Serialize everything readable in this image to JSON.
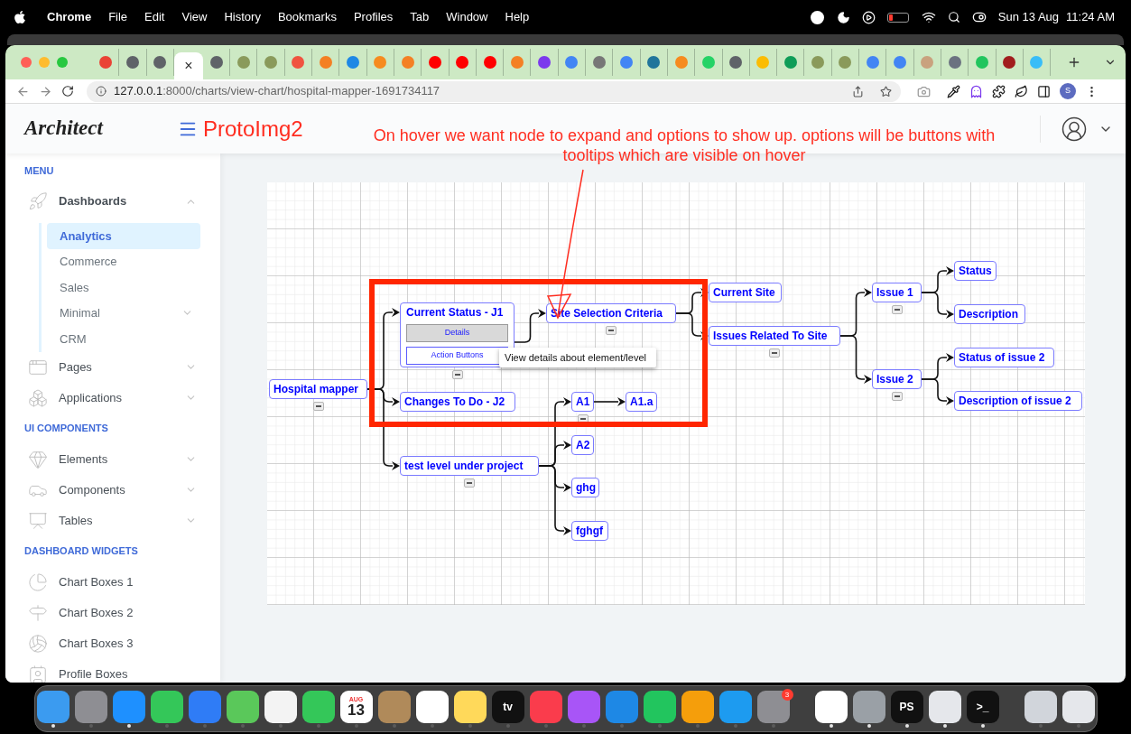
{
  "menubar": {
    "app": "Chrome",
    "menus": [
      "File",
      "Edit",
      "View",
      "History",
      "Bookmarks",
      "Profiles",
      "Tab",
      "Window",
      "Help"
    ],
    "date": "Sun 13 Aug",
    "time": "11:24 AM"
  },
  "browser": {
    "tabs": [
      {
        "selected": false
      },
      {
        "selected": false
      },
      {
        "selected": false
      },
      {
        "selected": true
      },
      {
        "selected": false
      },
      {
        "selected": false
      },
      {
        "selected": false
      },
      {
        "selected": false
      },
      {
        "selected": false
      },
      {
        "selected": false
      },
      {
        "selected": false
      },
      {
        "selected": false
      },
      {
        "selected": false
      },
      {
        "selected": false
      },
      {
        "selected": false
      },
      {
        "selected": false
      },
      {
        "selected": false
      },
      {
        "selected": false
      },
      {
        "selected": false
      },
      {
        "selected": false
      },
      {
        "selected": false
      },
      {
        "selected": false
      },
      {
        "selected": false
      },
      {
        "selected": false
      },
      {
        "selected": false
      },
      {
        "selected": false
      },
      {
        "selected": false
      },
      {
        "selected": false
      },
      {
        "selected": false
      },
      {
        "selected": false
      },
      {
        "selected": false
      },
      {
        "selected": false
      },
      {
        "selected": false
      },
      {
        "selected": false
      },
      {
        "selected": false
      }
    ],
    "close_glyph": "×",
    "url_host": "127.0.0.1",
    "url_path": ":8000/charts/view-chart/hospital-mapper-1691734117",
    "profile_initial": "S"
  },
  "app": {
    "logo": "Architect",
    "title": "ProtoImg2",
    "annotation": "On hover we want node to expand and options to show up. options will be buttons with tooltips which are visible on hover",
    "sidebar": [
      {
        "title": "MENU",
        "items": [
          {
            "label": "Dashboards",
            "kind": "group",
            "expanded": true,
            "children": [
              {
                "label": "Analytics",
                "kind": "link",
                "selected": true
              },
              {
                "label": "Commerce",
                "kind": "link",
                "selected": false
              },
              {
                "label": "Sales",
                "kind": "link",
                "selected": false
              },
              {
                "label": "Minimal",
                "kind": "group",
                "expanded": false,
                "selected": false
              },
              {
                "label": "CRM",
                "kind": "link",
                "selected": false
              }
            ]
          },
          {
            "label": "Pages",
            "kind": "group",
            "expanded": false
          },
          {
            "label": "Applications",
            "kind": "group",
            "expanded": false
          }
        ]
      },
      {
        "title": "UI COMPONENTS",
        "items": [
          {
            "label": "Elements",
            "kind": "group",
            "expanded": false
          },
          {
            "label": "Components",
            "kind": "group",
            "expanded": false
          },
          {
            "label": "Tables",
            "kind": "group",
            "expanded": false
          }
        ]
      },
      {
        "title": "DASHBOARD WIDGETS",
        "items": [
          {
            "label": "Chart Boxes 1",
            "kind": "link"
          },
          {
            "label": "Chart Boxes 2",
            "kind": "link"
          },
          {
            "label": "Chart Boxes 3",
            "kind": "link"
          },
          {
            "label": "Profile Boxes",
            "kind": "link"
          }
        ]
      }
    ]
  },
  "diagram": {
    "tooltip": "View details about element/level",
    "tree": {
      "label": "Hospital mapper",
      "expanded": true,
      "children": [
        {
          "label": "Current Status - J1",
          "expanded": true,
          "buttons": [
            {
              "label": "Details",
              "hovered": true
            },
            {
              "label": "Action Buttons",
              "hovered": false
            }
          ],
          "children": [
            {
              "label": "Site Selection Criteria",
              "expanded": true,
              "children": [
                {
                  "label": "Current Site"
                },
                {
                  "label": "Issues Related To Site",
                  "expanded": true,
                  "children": [
                    {
                      "label": "Issue 1",
                      "expanded": true,
                      "children": [
                        {
                          "label": "Status"
                        },
                        {
                          "label": "Description"
                        }
                      ]
                    },
                    {
                      "label": "Issue 2",
                      "expanded": true,
                      "children": [
                        {
                          "label": "Status of issue 2"
                        },
                        {
                          "label": "Description of issue 2"
                        }
                      ]
                    }
                  ]
                }
              ]
            }
          ]
        },
        {
          "label": "Changes To Do - J2"
        },
        {
          "label": "test level under project",
          "expanded": true,
          "children": [
            {
              "label": "A1",
              "expanded": true,
              "children": [
                {
                  "label": "A1.a"
                }
              ]
            },
            {
              "label": "A2"
            },
            {
              "label": "ghg"
            },
            {
              "label": "fghgf"
            }
          ]
        }
      ]
    }
  },
  "dock": {
    "items": [
      {
        "kind": "app",
        "running": true
      },
      {
        "kind": "app",
        "running": false
      },
      {
        "kind": "app",
        "running": true
      },
      {
        "kind": "app",
        "running": false
      },
      {
        "kind": "app",
        "running": false
      },
      {
        "kind": "app",
        "running": false
      },
      {
        "kind": "app",
        "running": false
      },
      {
        "kind": "app",
        "running": false
      },
      {
        "kind": "app",
        "running": false,
        "caption": "AUG",
        "label": "13"
      },
      {
        "kind": "app",
        "running": false
      },
      {
        "kind": "app",
        "running": false
      },
      {
        "kind": "app",
        "running": false
      },
      {
        "kind": "app",
        "running": false,
        "label": "tv"
      },
      {
        "kind": "app",
        "running": false
      },
      {
        "kind": "app",
        "running": false
      },
      {
        "kind": "app",
        "running": false
      },
      {
        "kind": "app",
        "running": false
      },
      {
        "kind": "app",
        "running": false
      },
      {
        "kind": "app",
        "running": false
      },
      {
        "kind": "app",
        "running": false,
        "badge": "3"
      },
      {
        "kind": "separator"
      },
      {
        "kind": "app",
        "running": true
      },
      {
        "kind": "app",
        "running": true
      },
      {
        "kind": "app",
        "running": true,
        "label": "PS"
      },
      {
        "kind": "app",
        "running": true
      },
      {
        "kind": "app",
        "running": true,
        "label": ">_"
      },
      {
        "kind": "separator"
      },
      {
        "kind": "app",
        "running": false
      },
      {
        "kind": "app",
        "running": false
      }
    ]
  }
}
